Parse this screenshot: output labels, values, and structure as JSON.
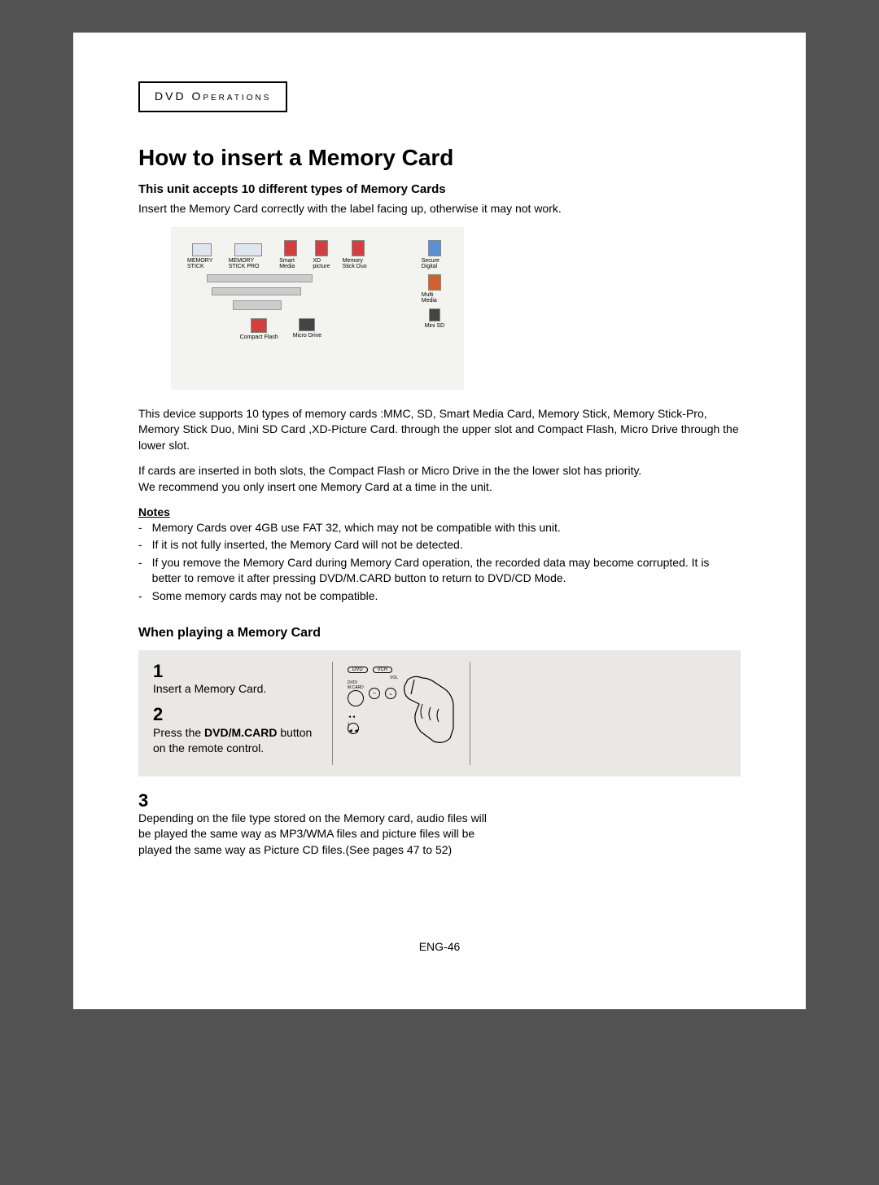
{
  "section_label": "DVD Operations",
  "title": "How to insert a Memory Card",
  "subheading": "This unit accepts 10 different types of Memory Cards",
  "intro_text": "Insert the Memory Card correctly with the label facing up, otherwise it may not work.",
  "diagram": {
    "labels": [
      "MEMORY STICK",
      "MEMORY STICK PRO",
      "Smart Media",
      "XD picture",
      "Memory Stick Duo"
    ],
    "right_labels": [
      "Secure Digital",
      "Multi Media",
      "Mini SD"
    ],
    "bottom_labels": [
      "Compact Flash",
      "Micro Drive"
    ]
  },
  "para1": "This device supports 10 types of memory cards :MMC, SD, Smart Media Card, Memory Stick, Memory Stick-Pro, Memory Stick Duo, Mini SD Card ,XD-Picture Card. through the upper slot and Compact Flash, Micro Drive through the lower slot.",
  "para2": "If cards are inserted in both slots, the Compact Flash or Micro Drive in the the lower slot has priority.",
  "para3": "We recommend you only insert one Memory Card at a time in the unit.",
  "notes_label": "Notes",
  "notes": [
    "Memory Cards over 4GB use FAT 32, which may not be compatible with this unit.",
    "If it is not fully inserted, the Memory Card will not be detected.",
    "If you remove the Memory Card during Memory Card operation, the recorded data may become corrupted. It is better to remove it after pressing DVD/M.CARD button to return to DVD/CD Mode.",
    "Some memory cards may not be compatible."
  ],
  "subheading2": "When playing a Memory Card",
  "steps": {
    "step1_num": "1",
    "step1_text": "Insert a Memory Card.",
    "step2_num": "2",
    "step2_prefix": "Press the ",
    "step2_bold": "DVD/M.CARD",
    "step2_suffix": " button on the remote control.",
    "step3_num": "3",
    "step3_text": "Depending on the file type stored on the Memory card, audio files will be played the same way as MP3/WMA files and picture files will be played the same way as Picture CD files.(See pages 47 to 52)"
  },
  "remote": {
    "dvd": "DVD",
    "vcr": "VCR",
    "vol": "VOL",
    "dvd_mcard": "DVD/\nM.CARD",
    "minus": "–",
    "down": "⌄",
    "rewind": "◄◄",
    "skip": "|◄◄"
  },
  "footer": "ENG-46"
}
